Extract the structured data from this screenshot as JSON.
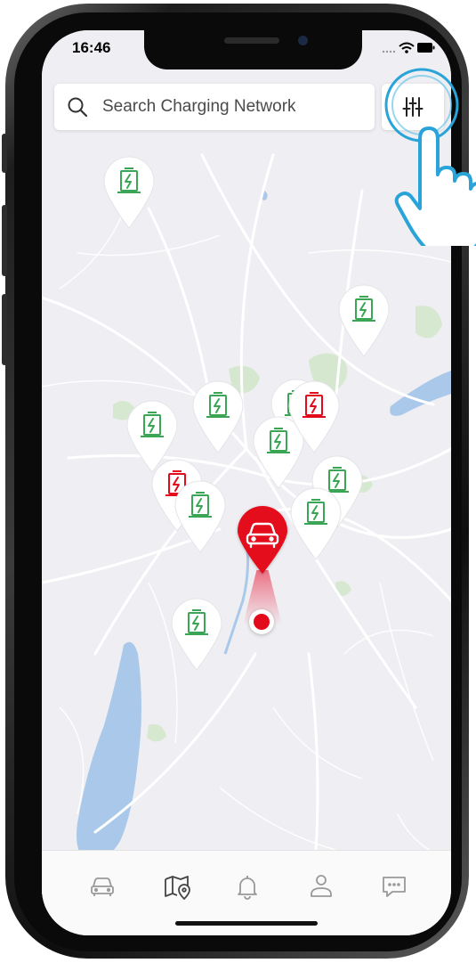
{
  "status_bar": {
    "time": "16:46"
  },
  "search": {
    "placeholder": "Search Charging Network"
  },
  "filter": {
    "icon": "sliders-icon"
  },
  "colors": {
    "available": "#3aa655",
    "occupied": "#e30a1c",
    "car_pin": "#e30a1c",
    "map_background": "#efeff3",
    "water": "#aac9ea",
    "park": "#d3e7cc"
  },
  "map": {
    "stations": [
      {
        "status": "available"
      },
      {
        "status": "available"
      },
      {
        "status": "available"
      },
      {
        "status": "available"
      },
      {
        "status": "occupied"
      },
      {
        "status": "available"
      },
      {
        "status": "available"
      },
      {
        "status": "occupied"
      },
      {
        "status": "available"
      },
      {
        "status": "available"
      },
      {
        "status": "available"
      },
      {
        "status": "available"
      }
    ],
    "vehicle_icon": "car-icon",
    "current_location_icon": "location-dot-icon"
  },
  "tab_bar": {
    "items": [
      {
        "name": "car",
        "icon": "car-icon",
        "active": false
      },
      {
        "name": "map",
        "icon": "map-pin-icon",
        "active": true
      },
      {
        "name": "notifications",
        "icon": "bell-icon",
        "active": false
      },
      {
        "name": "profile",
        "icon": "user-icon",
        "active": false
      },
      {
        "name": "messages",
        "icon": "chat-icon",
        "active": false
      }
    ]
  }
}
